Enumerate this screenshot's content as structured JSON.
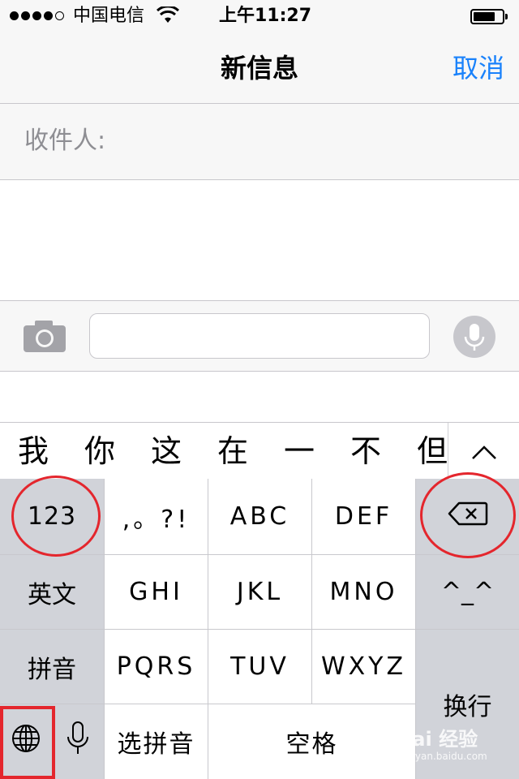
{
  "status_bar": {
    "carrier": "中国电信",
    "time": "上午11:27",
    "signal_bars_filled": 4,
    "signal_bars_total": 5,
    "battery_level": 0.7
  },
  "nav": {
    "title": "新信息",
    "cancel_label": "取消"
  },
  "recipient": {
    "label": "收件人:"
  },
  "compose": {
    "camera_icon": "camera-icon",
    "dictation_icon": "microphone-icon"
  },
  "candidates": {
    "items": [
      "我",
      "你",
      "这",
      "在",
      "一",
      "不",
      "但"
    ],
    "expand_icon": "chevron-up-icon"
  },
  "keyboard": {
    "num_key": "123",
    "punct_key": ",。?!",
    "abc_key": "ABC",
    "def_key": "DEF",
    "english_key": "英文",
    "ghi_key": "GHI",
    "jkl_key": "JKL",
    "mno_key": "MNO",
    "emoticon_key": "^_^",
    "pinyin_key": "拼音",
    "pqrs_key": "PQRS",
    "tuv_key": "TUV",
    "wxyz_key": "WXYZ",
    "return_key": "换行",
    "select_pinyin_key": "选拼音",
    "space_key": "空格",
    "delete_icon": "backspace-icon",
    "globe_icon": "globe-icon",
    "mic_icon": "microphone-icon"
  },
  "watermark": {
    "main": "Bai 经验",
    "sub": "jingyan.baidu.com"
  },
  "colors": {
    "accent": "#1a82fb",
    "annotation": "#e4262d",
    "key_white": "#ffffff",
    "key_gray": "#d1d3d9"
  }
}
